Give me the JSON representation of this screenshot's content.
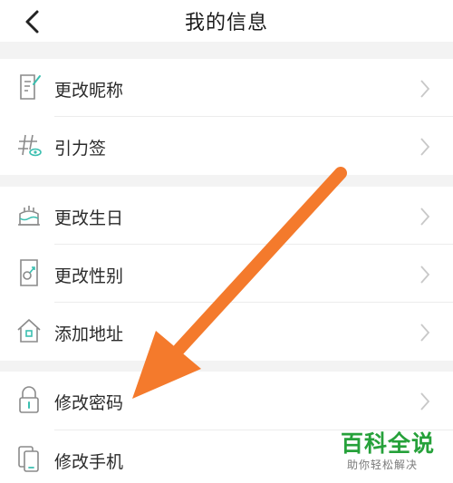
{
  "header": {
    "title": "我的信息"
  },
  "groups": [
    {
      "items": [
        {
          "label": "更改昵称",
          "icon": "note-edit-icon"
        },
        {
          "label": "引力签",
          "icon": "hashtag-eye-icon"
        }
      ]
    },
    {
      "items": [
        {
          "label": "更改生日",
          "icon": "cake-icon"
        },
        {
          "label": "更改性别",
          "icon": "gender-icon"
        },
        {
          "label": "添加地址",
          "icon": "home-icon"
        }
      ]
    },
    {
      "items": [
        {
          "label": "修改密码",
          "icon": "lock-icon"
        },
        {
          "label": "修改手机",
          "icon": "phone-icon"
        }
      ]
    }
  ],
  "watermark": {
    "brand": "百科全说",
    "slogan": "助你轻松解决"
  },
  "colors": {
    "icon_stroke": "#8a8a8a",
    "icon_accent": "#3bbfb0",
    "arrow": "#f47a2c",
    "watermark": "#26a13a"
  }
}
